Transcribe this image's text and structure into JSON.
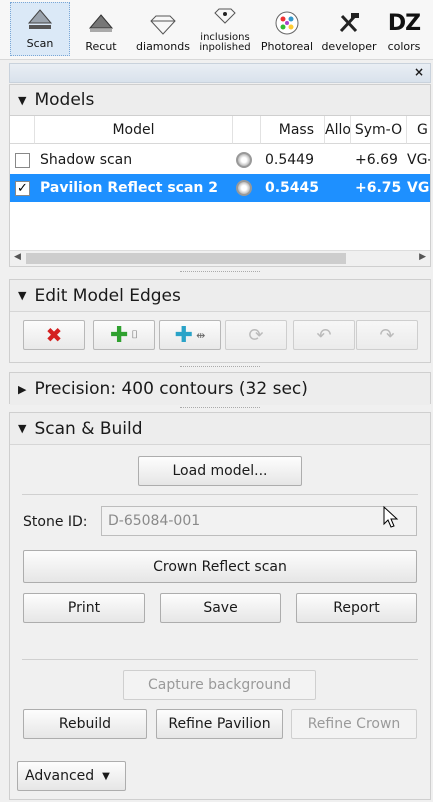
{
  "toolbar": {
    "items": [
      {
        "label": "Scan",
        "icon": "scan-icon",
        "active": true
      },
      {
        "label": "Recut",
        "icon": "recut-icon"
      },
      {
        "label": "diamonds",
        "icon": "diamond-icon"
      },
      {
        "label_line1": "inclusions",
        "label_line2": "inpolished",
        "icon": "inclusion-diamond-icon"
      },
      {
        "label": "Photoreal",
        "icon": "photoreal-icon"
      },
      {
        "label": "developer",
        "icon": "tools-icon"
      },
      {
        "label": "colors",
        "icon_text": "DZ"
      }
    ]
  },
  "panel": {
    "close_label": "×"
  },
  "models": {
    "title": "Models",
    "columns": [
      "Model",
      "Mass",
      "Allo",
      "Sym-O",
      "G"
    ],
    "rows": [
      {
        "checked": false,
        "name": "Shadow scan",
        "mass": "0.5449",
        "sym": "+6.69",
        "g": "VG-",
        "selected": false
      },
      {
        "checked": true,
        "name": "Pavilion Reflect scan 2",
        "mass": "0.5445",
        "sym": "+6.75",
        "g": "VG-",
        "selected": true
      }
    ]
  },
  "edit_edges": {
    "title": "Edit Model Edges"
  },
  "precision": {
    "title": "Precision: 400 contours (32 sec)"
  },
  "scan_build": {
    "title": "Scan & Build",
    "load_model": "Load model...",
    "stone_id_label": "Stone ID:",
    "stone_id_value": "D-65084-001",
    "crown_reflect": "Crown Reflect scan",
    "print": "Print",
    "save": "Save",
    "report": "Report",
    "capture_bg": "Capture background",
    "rebuild": "Rebuild",
    "refine_pavilion": "Refine Pavilion",
    "refine_crown": "Refine Crown"
  },
  "advanced": {
    "label": "Advanced"
  },
  "colors": {
    "selection": "#1e90ff",
    "delete_red": "#d42020",
    "add_green": "#2fa12f",
    "add_teal": "#2aa3c8"
  }
}
